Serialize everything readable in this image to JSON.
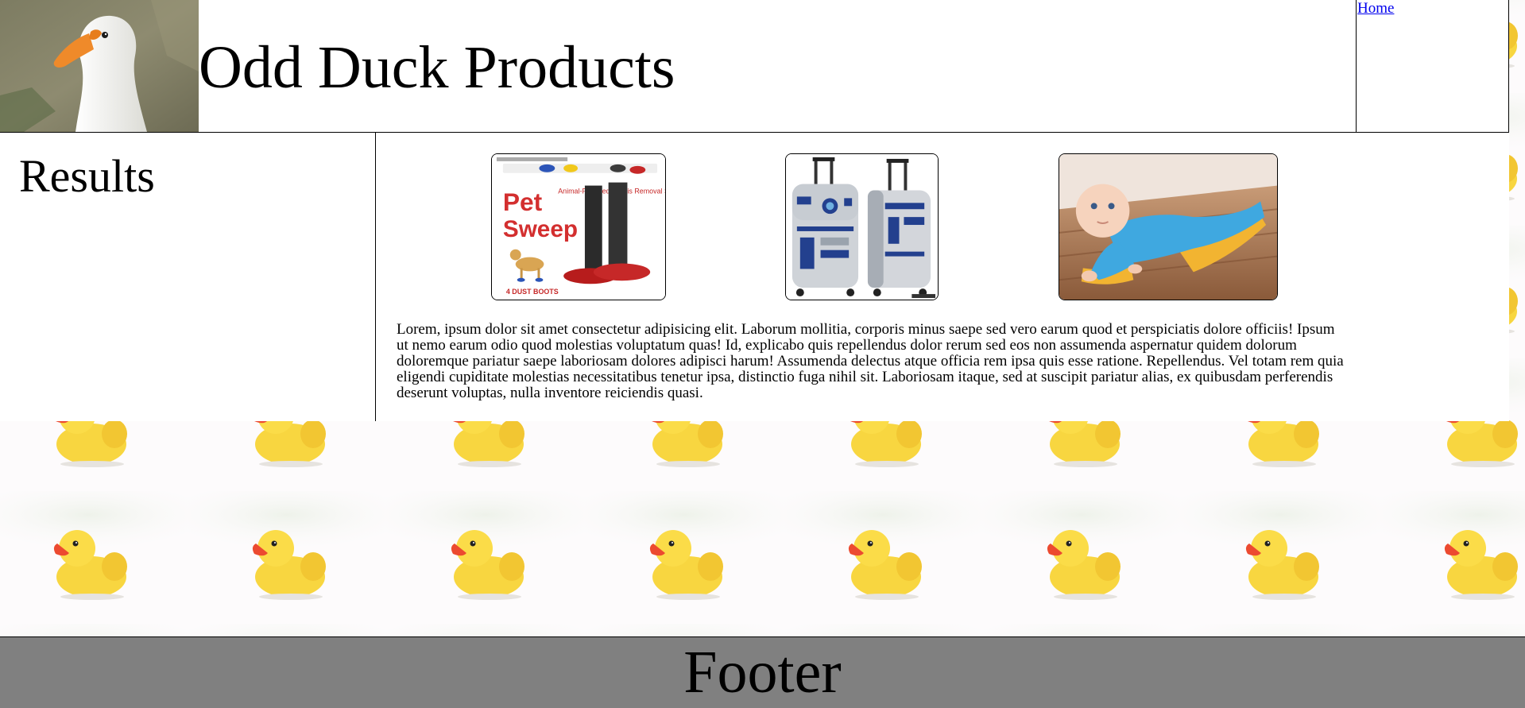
{
  "header": {
    "title": "Odd Duck Products",
    "logo_icon": "goose-photo"
  },
  "nav": {
    "home_label": "Home"
  },
  "sidebar": {
    "heading": "Results"
  },
  "main": {
    "products": [
      {
        "icon": "pet-sweep-product-image",
        "box_text_1": "Pet",
        "box_text_2": "Sweep",
        "box_tagline": "Animal-Powered Debris Removal System",
        "box_bottom": "4 DUST BOOTS"
      },
      {
        "icon": "r2d2-luggage-product-image"
      },
      {
        "icon": "baby-sweeper-product-image"
      }
    ],
    "description": "Lorem, ipsum dolor sit amet consectetur adipisicing elit. Laborum mollitia, corporis minus saepe sed vero earum quod et perspiciatis dolore officiis! Ipsum ut nemo earum odio quod molestias voluptatum quas! Id, explicabo quis repellendus dolor rerum sed eos non assumenda aspernatur quidem dolorum doloremque pariatur saepe laboriosam dolores adipisci harum! Assumenda delectus atque officia rem ipsa quis esse ratione. Repellendus. Vel totam rem quia eligendi cupiditate molestias necessitatibus tenetur ipsa, distinctio fuga nihil sit. Laboriosam itaque, sed at suscipit pariatur alias, ex quibusdam perferendis deserunt voluptas, nulla inventore reiciendis quasi."
  },
  "footer": {
    "label": "Footer"
  },
  "background": {
    "pattern_icon": "rubber-duck-pattern",
    "duck_color": "#f8d640",
    "footer_color": "#808080",
    "link_color": "#0000ee"
  }
}
